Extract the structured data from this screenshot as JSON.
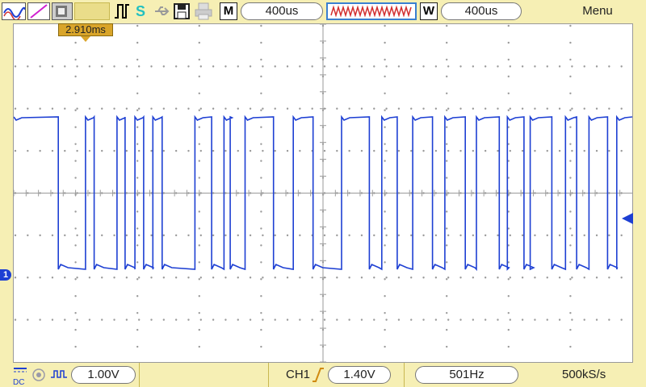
{
  "toolbar": {
    "icons": [
      "ch1-waveform-icon",
      "math-icon",
      "reference-icon",
      "run-stop-icon",
      "pulse-trigger-icon",
      "save-icon",
      "print-icon"
    ],
    "s_label": "S",
    "main_timebase_button": "M",
    "main_timebase_value": "400us",
    "window_button": "W",
    "window_timebase_value": "400us",
    "menu_label": "Menu"
  },
  "cursor": {
    "readout": "2.910ms"
  },
  "channel": {
    "marker_label": "1"
  },
  "status": {
    "coupling": "DC",
    "ch1_scale": "1.00V",
    "trigger_source": "CH1",
    "trigger_level": "1.40V",
    "frequency": "501Hz",
    "sample_rate": "500kS/s"
  },
  "colors": {
    "trace": "#1d3fd3",
    "background": "#f6efb4",
    "cursor": "#d9a52a",
    "grid": "#9a9a9a"
  },
  "waveform": {
    "description_units": "divisions",
    "transitions_div": [
      0.0,
      0.72,
      1.16,
      1.3,
      1.67,
      1.8,
      1.96,
      2.1,
      2.25,
      2.4,
      2.93,
      3.2,
      3.4,
      3.5,
      3.74,
      4.2,
      4.52,
      4.84,
      5.3,
      5.75,
      5.95,
      6.2,
      6.45,
      6.77,
      6.97,
      7.3,
      7.48,
      7.85,
      7.98,
      8.25,
      8.35,
      8.7,
      8.92,
      9.1,
      9.3,
      9.6,
      9.75,
      10.0
    ],
    "high_level_div": 3.0,
    "low_level_div": -1.0
  }
}
